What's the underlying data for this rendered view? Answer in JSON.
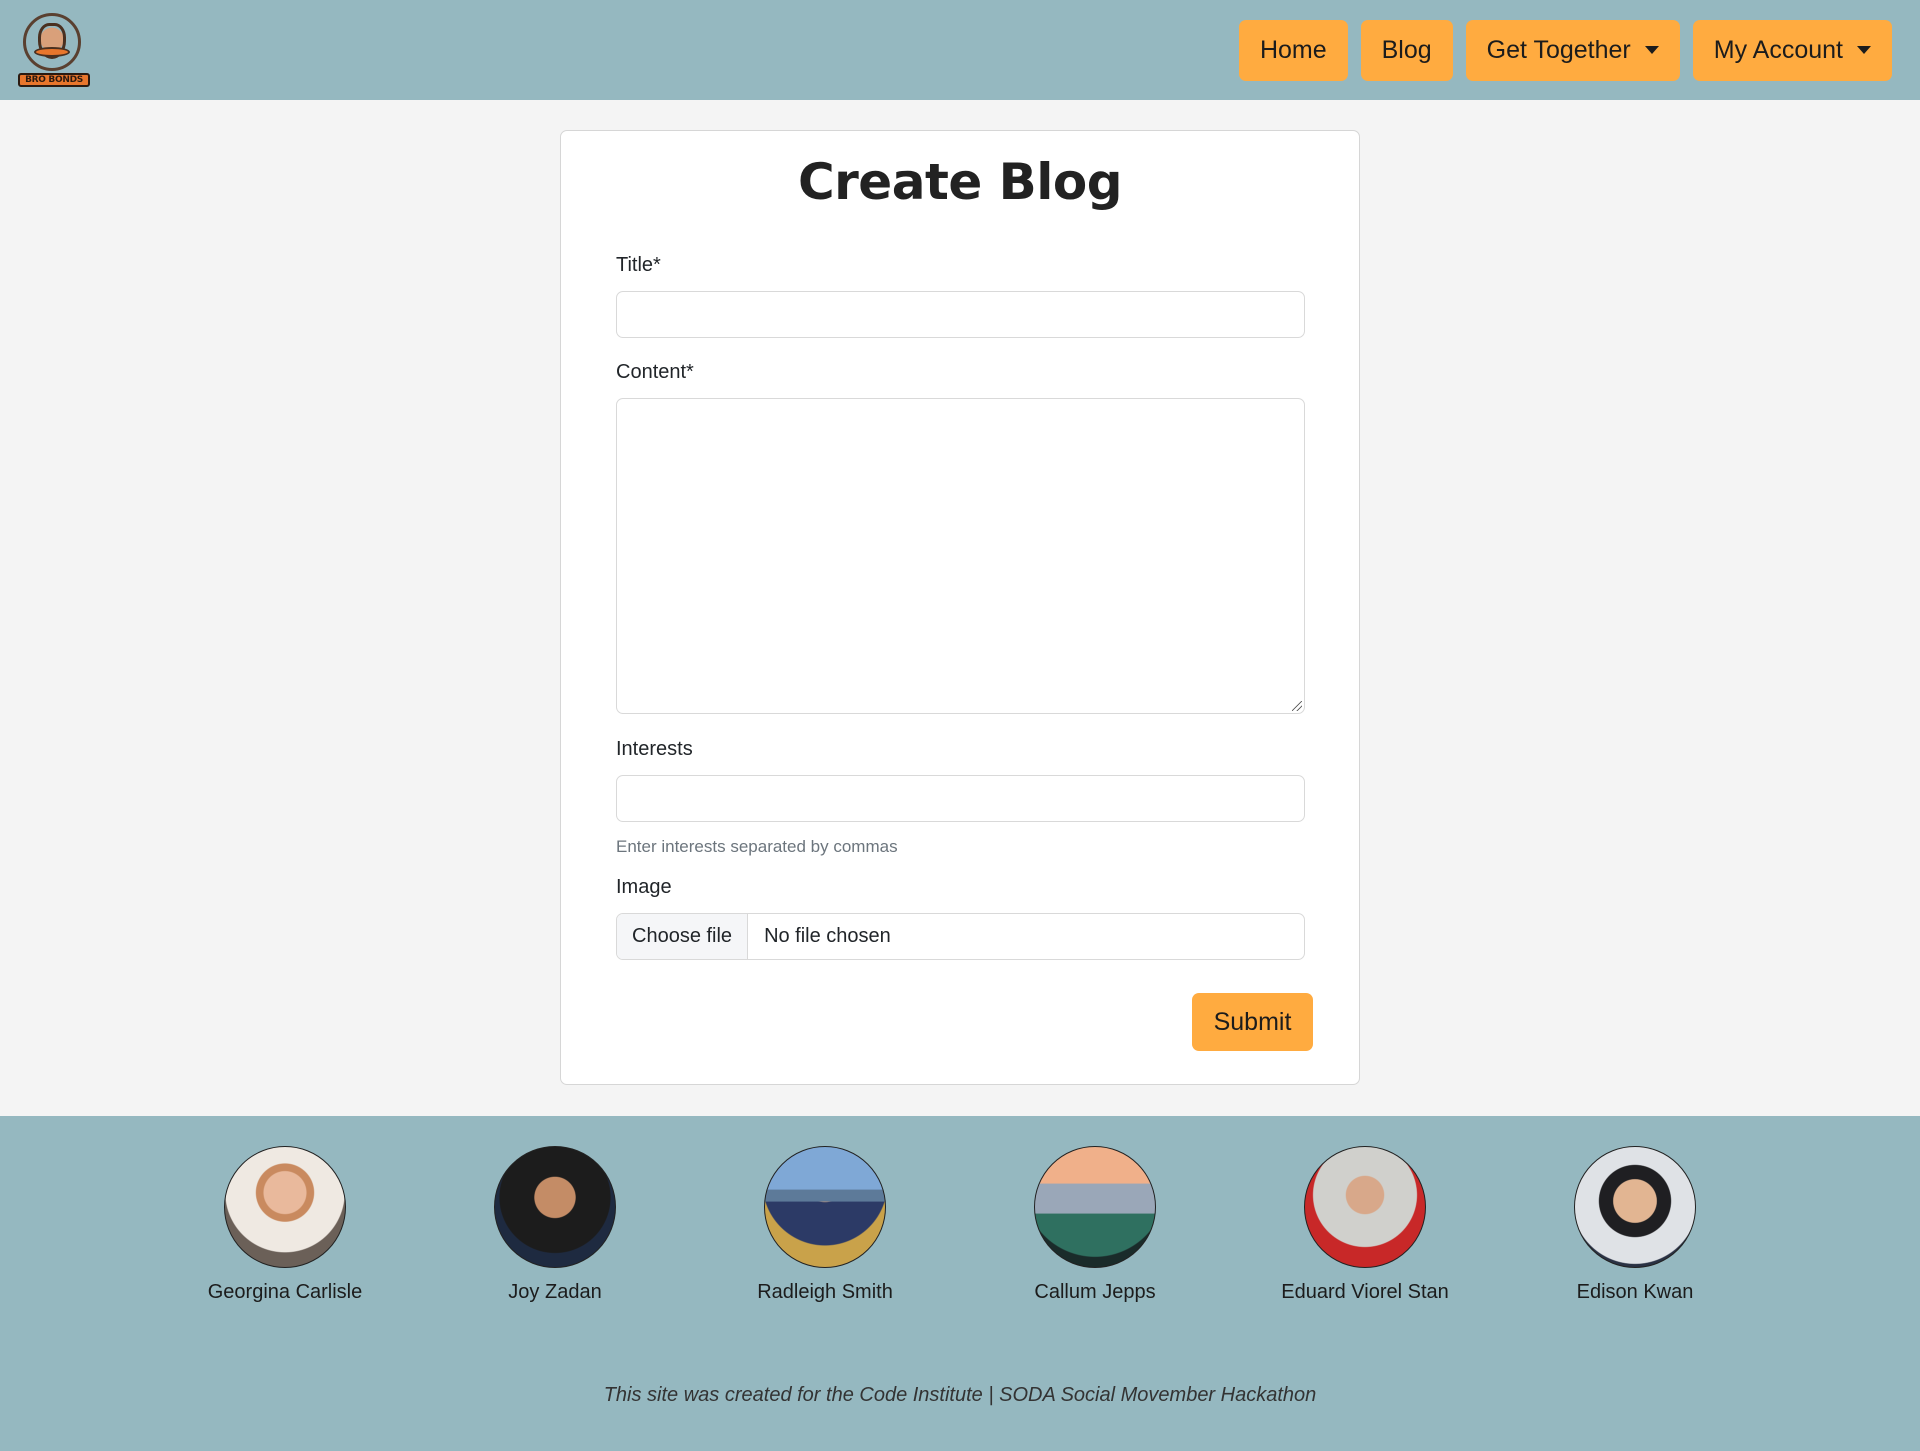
{
  "brand": {
    "logo_text": "BRO BONDS"
  },
  "nav": {
    "items": [
      {
        "label": "Home"
      },
      {
        "label": "Blog"
      },
      {
        "label": "Get Together"
      },
      {
        "label": "My Account"
      }
    ]
  },
  "form": {
    "heading": "Create Blog",
    "title_label": "Title*",
    "title_value": "",
    "content_label": "Content*",
    "content_value": "",
    "interests_label": "Interests",
    "interests_value": "",
    "interests_help": "Enter interests separated by commas",
    "image_label": "Image",
    "file_button": "Choose file",
    "file_status": "No file chosen",
    "submit_label": "Submit"
  },
  "footer": {
    "team": [
      {
        "name": "Georgina Carlisle"
      },
      {
        "name": "Joy Zadan"
      },
      {
        "name": "Radleigh Smith"
      },
      {
        "name": "Callum Jepps"
      },
      {
        "name": "Eduard Viorel Stan"
      },
      {
        "name": "Edison Kwan"
      }
    ],
    "credit": "This site was created for the Code Institute | SODA Social Movember Hackathon"
  },
  "colors": {
    "nav_bg": "#95b8c0",
    "accent": "#ffab40",
    "page_bg": "#f4f4f4"
  }
}
